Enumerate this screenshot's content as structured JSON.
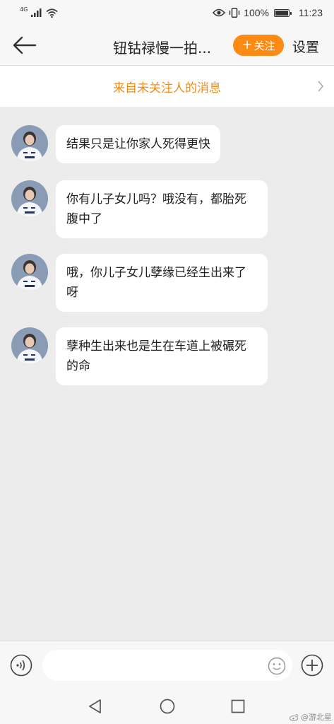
{
  "status_bar": {
    "network_type": "4G",
    "battery_percent": "100%",
    "time": "11:23"
  },
  "header": {
    "title": "钮钴禄慢一拍...",
    "follow_label": "关注",
    "settings_label": "设置"
  },
  "banner": {
    "text": "来自未关注人的消息"
  },
  "messages": [
    {
      "sender": "other",
      "text": "结果只是让你家人死得更快"
    },
    {
      "sender": "other",
      "text": "你有儿子女儿吗？哦没有，都胎死腹中了"
    },
    {
      "sender": "other",
      "text": "哦，你儿子女儿孽缘已经生出来了呀"
    },
    {
      "sender": "other",
      "text": "孽种生出来也是生在车道上被碾死的命"
    }
  ],
  "input_bar": {
    "placeholder": ""
  },
  "watermark": {
    "text": "@游北星"
  },
  "colors": {
    "accent": "#fd8a12",
    "banner_text": "#ee8b1d",
    "chat_background": "#ececec"
  }
}
